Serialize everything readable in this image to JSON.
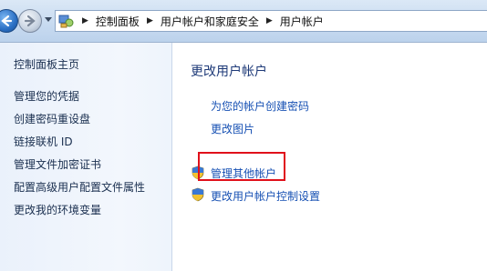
{
  "nav": {
    "breadcrumbs": [
      "控制面板",
      "用户帐户和家庭安全",
      "用户帐户"
    ]
  },
  "sidebar": {
    "items": [
      {
        "label": "控制面板主页"
      },
      {
        "label": "管理您的凭据"
      },
      {
        "label": "创建密码重设盘"
      },
      {
        "label": "链接联机 ID"
      },
      {
        "label": "管理文件加密证书"
      },
      {
        "label": "配置高级用户配置文件属性"
      },
      {
        "label": "更改我的环境变量"
      }
    ]
  },
  "main": {
    "title": "更改用户帐户",
    "links": [
      {
        "label": "为您的帐户创建密码"
      },
      {
        "label": "更改图片"
      }
    ],
    "admin_links": [
      {
        "label": "管理其他帐户",
        "icon": "uac-shield-icon"
      },
      {
        "label": "更改用户帐户控制设置",
        "icon": "uac-shield-icon"
      }
    ],
    "highlight_color": "#e0101a"
  }
}
